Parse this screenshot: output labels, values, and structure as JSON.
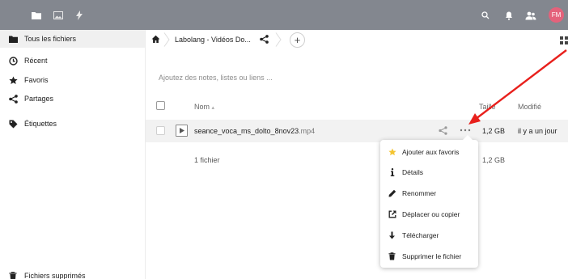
{
  "topbar": {
    "apps": [
      "files-icon",
      "photos-icon",
      "activity-icon"
    ],
    "right_icons": [
      "search-icon",
      "notifications-icon",
      "contacts-icon"
    ],
    "avatar_initials": "FM",
    "background": "#83878f",
    "avatar_color": "#e4627b"
  },
  "sidebar": {
    "items": [
      {
        "label": "Tous les fichiers",
        "icon": "folder-icon"
      },
      {
        "label": "Récent",
        "icon": "clock-icon"
      },
      {
        "label": "Favoris",
        "icon": "star-icon"
      },
      {
        "label": "Partages",
        "icon": "share-icon"
      },
      {
        "label": "Étiquettes",
        "icon": "tag-icon"
      }
    ],
    "bottom_label": "Fichiers supprimés"
  },
  "breadcrumb": {
    "folder": "Labolang - Vidéos Do...",
    "add_label": "+"
  },
  "notes_placeholder": "Ajoutez des notes, listes ou liens ...",
  "table": {
    "headers": {
      "name": "Nom",
      "name_sort_glyph": "▴",
      "size": "Taille",
      "modified": "Modifié"
    },
    "rows": [
      {
        "name": "seance_voca_ms_dolto_8nov23",
        "ext": ".mp4",
        "size": "1,2 GB",
        "modified": "il y a un jour"
      }
    ],
    "summary": {
      "count": "1 fichier",
      "size": "1,2 GB"
    }
  },
  "menu": {
    "items": [
      {
        "label": "Ajouter aux favoris",
        "icon": "star-icon"
      },
      {
        "label": "Détails",
        "icon": "info-icon"
      },
      {
        "label": "Renommer",
        "icon": "pencil-icon"
      },
      {
        "label": "Déplacer ou copier",
        "icon": "external-link-icon"
      },
      {
        "label": "Télécharger",
        "icon": "download-icon"
      },
      {
        "label": "Supprimer le fichier",
        "icon": "trash-icon"
      }
    ]
  },
  "colors": {
    "annotation_arrow": "#e8201c",
    "favorite_star": "#f4c430"
  }
}
